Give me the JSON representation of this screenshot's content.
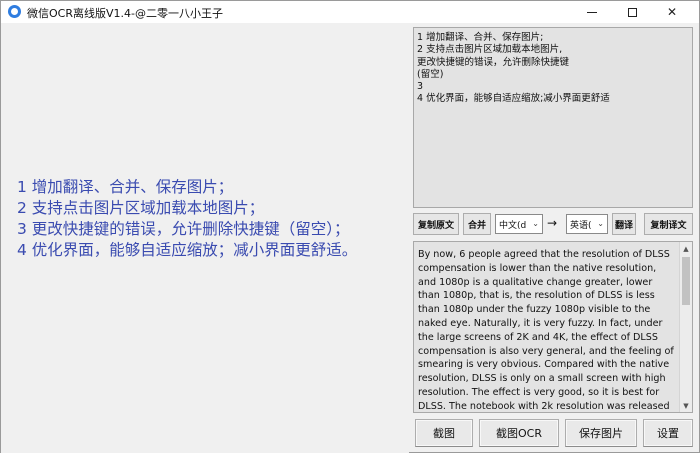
{
  "window": {
    "title": "微信OCR离线版V1.4-@二零一八小王子",
    "icon": "app-logo-icon"
  },
  "image_area": {
    "lines": [
      "1 增加翻译、合并、保存图片；",
      "2 支持点击图片区域加载本地图片；",
      "3 更改快捷键的错误，允许删除快捷键（留空）；",
      "4 优化界面，能够自适应缩放；减小界面更舒适。"
    ],
    "text_color": "#3a4bb0"
  },
  "ocr_result": {
    "lines": [
      "1 增加翻译、合并、保存图片;",
      "2 支持点击图片区域加载本地图片,",
      "更改快捷键的错误，允许删除快捷键",
      "(留空)",
      "3",
      "4 优化界面，能够自适应缩放;减小界面更舒适"
    ]
  },
  "toolbar": {
    "copy_source_label": "复制原文",
    "merge_label": "合并",
    "source_lang": "中文(d",
    "arrow": "→",
    "target_lang": "英语(",
    "translate_label": "翻译",
    "copy_translation_label": "复制译文"
  },
  "translation": {
    "text": "By now, 6 people agreed that the resolution of DLSS compensation is lower than the native resolution, and 1080p is a qualitative change greater, lower than 1080p, that is, the resolution of DLSS is less than 1080p under the fuzzy 1080p visible to the naked eye. Naturally, it is very fuzzy. In fact, under the large screens of 2K and 4K, the effect of DLSS compensation is also very general, and the feeling of smearing is very obvious. Compared with the native resolution, DLSS is only on a small screen with high resolution. The effect is very good, so it is best for DLSS. The notebook with 2k resolution was released"
  },
  "bottom": {
    "screenshot_label": "截图",
    "screenshot_ocr_label": "截图OCR",
    "save_image_label": "保存图片",
    "settings_label": "设置"
  }
}
